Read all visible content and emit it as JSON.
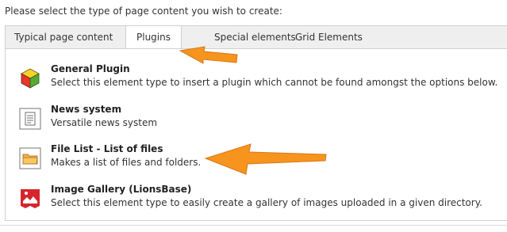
{
  "intro_text": "Please select the type of page content you wish to create:",
  "tabs": [
    {
      "label": "Typical page content",
      "active": false
    },
    {
      "label": "Plugins",
      "active": true
    },
    {
      "label": "Special elements",
      "active": false
    },
    {
      "label": "Grid Elements",
      "active": false
    }
  ],
  "items": [
    {
      "title": "General Plugin",
      "description": "Select this element type to insert a plugin which cannot be found amongst the options below.",
      "icon": "cube-icon"
    },
    {
      "title": "News system",
      "description": "Versatile news system",
      "icon": "document-icon"
    },
    {
      "title": "File List - List of files",
      "description": "Makes a list of files and folders.",
      "icon": "folder-icon"
    },
    {
      "title": "Image Gallery (LionsBase)",
      "description": "Select this element type to easily create a gallery of images uploaded in a given directory.",
      "icon": "gallery-icon"
    }
  ],
  "colors": {
    "annotation_arrow": "#f7941d",
    "tab_bar": "#efefef",
    "border": "#cfcfcf"
  }
}
